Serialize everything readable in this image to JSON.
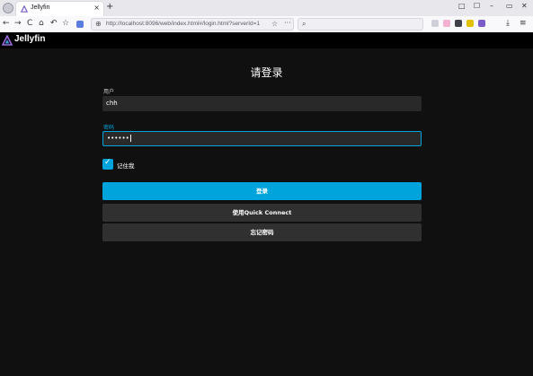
{
  "browser": {
    "tab_title": "Jellyfin",
    "tab_close": "×",
    "new_tab": "+",
    "window_controls": [
      "□",
      "☐",
      "–",
      "▭",
      "✕"
    ],
    "nav": {
      "back": "←",
      "forward": "→",
      "reload": "C",
      "home": "⌂",
      "undo": "↶",
      "star": "☆"
    },
    "url": "http://localhost:8096/web/index.html#/login.html?serverId=1",
    "url_star": "☆",
    "url_more": "···",
    "menu": "≡",
    "download": "⤓",
    "extension_colors": [
      "#cfcfd8",
      "#f4b0d0",
      "#404048",
      "#e2c000",
      "#7b5cc8"
    ]
  },
  "app": {
    "brand": "Jellyfin",
    "accent_color": "#00a4dc",
    "login": {
      "title": "请登录",
      "username_label": "用户",
      "username_value": "chh",
      "password_label": "密码",
      "password_value": "••••••",
      "remember_label": "记住我",
      "remember_checked": true,
      "sign_in_button": "登录",
      "quick_connect_button": "使用Quick Connect",
      "forgot_button": "忘记密码"
    }
  }
}
